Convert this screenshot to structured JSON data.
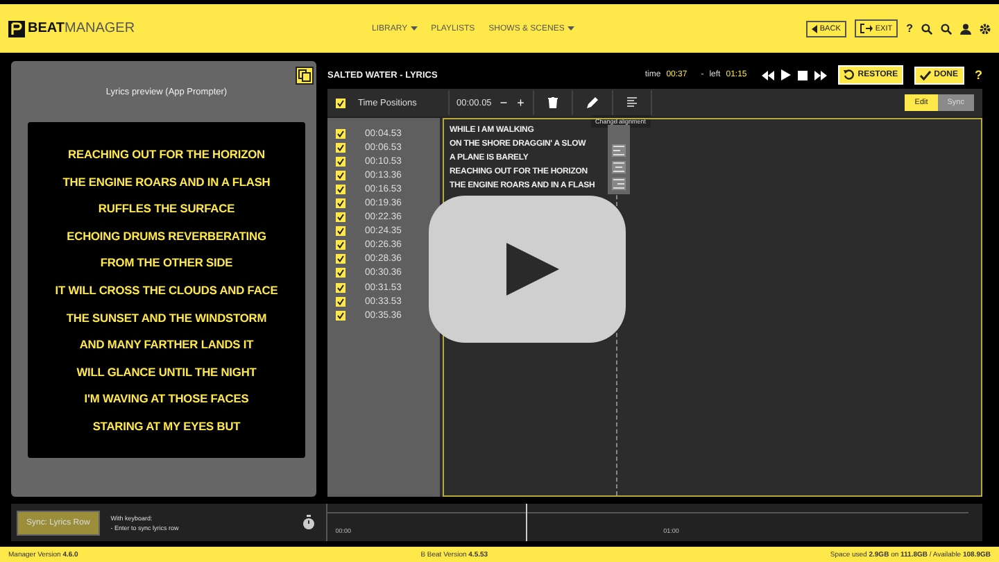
{
  "header": {
    "logo_bold": "BEAT",
    "logo_light": "MANAGER",
    "nav": [
      {
        "label": "LIBRARY",
        "dropdown": true
      },
      {
        "label": "PLAYLISTS",
        "dropdown": false
      },
      {
        "label": "SHOWS & SCENES",
        "dropdown": true
      }
    ],
    "back": "BACK",
    "exit": "EXIT",
    "help": "?"
  },
  "preview": {
    "title": "Lyrics preview (App Prompter)",
    "lines": [
      "REACHING OUT FOR THE HORIZON",
      "THE ENGINE ROARS AND IN A FLASH",
      "RUFFLES THE SURFACE",
      "ECHOING DRUMS REVERBERATING",
      "FROM THE OTHER SIDE",
      "IT WILL CROSS THE CLOUDS AND FACE",
      "THE SUNSET AND THE WINDSTORM",
      "AND MANY FARTHER LANDS IT",
      "WILL GLANCE UNTIL THE NIGHT",
      "I'M WAVING AT THOSE FACES",
      "STARING AT MY EYES BUT"
    ]
  },
  "editor": {
    "title": "SALTED WATER - LYRICS",
    "time_label": "time",
    "time": "00:37",
    "sep": "-",
    "left_label": "left",
    "left": "01:15",
    "restore": "RESTORE",
    "done": "DONE",
    "help": "?",
    "toolbar": {
      "all_checked": true,
      "label": "Time Positions",
      "step": "00:00.05",
      "minus": "−",
      "plus": "+",
      "tooltip": "Change alignment"
    },
    "modes": [
      {
        "label": "Edit",
        "selected": true
      },
      {
        "label": "Sync",
        "selected": false
      }
    ],
    "times": [
      {
        "time": "00:04.53",
        "checked": true
      },
      {
        "time": "00:06.53",
        "checked": true
      },
      {
        "time": "00:10.53",
        "checked": true
      },
      {
        "time": "00:13.36",
        "checked": true
      },
      {
        "time": "00:16.53",
        "checked": true
      },
      {
        "time": "00:19.36",
        "checked": true
      },
      {
        "time": "00:22.36",
        "checked": true
      },
      {
        "time": "00:24.35",
        "checked": true
      },
      {
        "time": "00:26.36",
        "checked": true
      },
      {
        "time": "00:28.36",
        "checked": true
      },
      {
        "time": "00:30.36",
        "checked": true
      },
      {
        "time": "00:31.53",
        "checked": true
      },
      {
        "time": "00:33.53",
        "checked": true
      },
      {
        "time": "00:35.36",
        "checked": true
      }
    ],
    "lines": [
      "WHILE I AM WALKING",
      "ON THE SHORE DRAGGIN' A SLOW",
      "A PLANE IS BARELY",
      "REACHING OUT FOR THE HORIZON",
      "THE ENGINE ROARS AND IN A FLASH"
    ]
  },
  "bottom": {
    "sync_button": "Sync: Lyrics Row",
    "hint_title": "With keyboard:",
    "hint": "- Enter to sync lyrics row",
    "ticks": [
      "00:00",
      "01:00"
    ],
    "level": 0.31
  },
  "footer": {
    "manager": "Manager Version **4.6.0**",
    "beat": "B Beat Version **4.5.53**",
    "space": "Space used **2.9GB** on **111.8GB** / Available **108.9GB**"
  }
}
